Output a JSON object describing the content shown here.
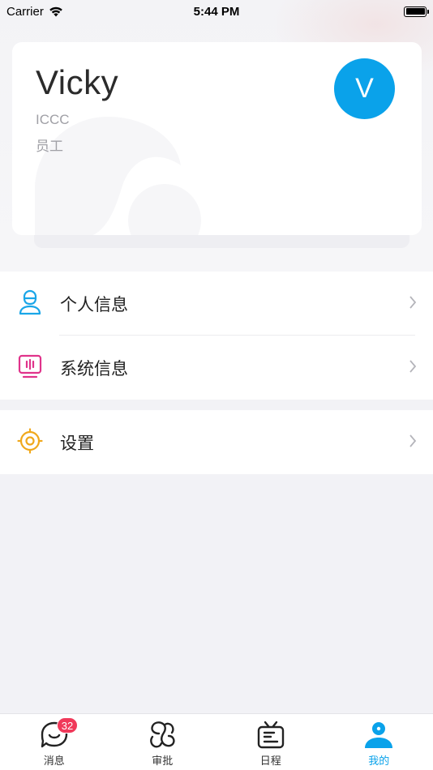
{
  "status_bar": {
    "carrier": "Carrier",
    "time": "5:44 PM"
  },
  "profile": {
    "name": "Vicky",
    "organization": "ICCC",
    "role": "员工",
    "avatar_letter": "V",
    "avatar_color": "#0aa2ea"
  },
  "menu": {
    "personal_info": {
      "label": "个人信息",
      "icon": "user-icon",
      "color": "#1aa6e8"
    },
    "system_info": {
      "label": "系统信息",
      "icon": "monitor-icon",
      "color": "#e0338b"
    },
    "settings": {
      "label": "设置",
      "icon": "target-gear-icon",
      "color": "#f0a81c"
    }
  },
  "tab_bar": {
    "tabs": [
      {
        "label": "消息",
        "icon": "message-icon",
        "badge": "32"
      },
      {
        "label": "审批",
        "icon": "approval-icon"
      },
      {
        "label": "日程",
        "icon": "schedule-icon"
      },
      {
        "label": "我的",
        "icon": "profile-icon",
        "active": true
      }
    ],
    "accent": "#0aa2ea"
  }
}
